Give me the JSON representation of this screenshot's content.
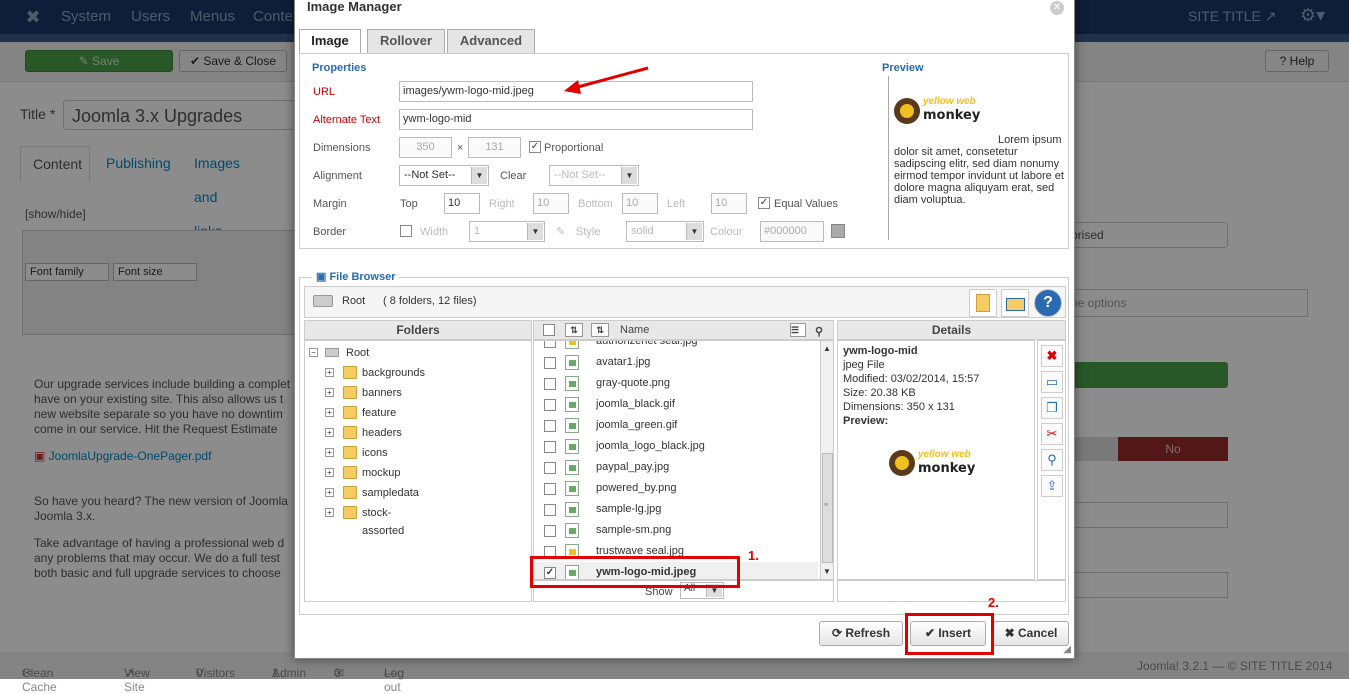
{
  "background": {
    "topbar": {
      "menu": [
        "System",
        "Users",
        "Menus",
        "Conte"
      ],
      "site_title": "SITE TITLE"
    },
    "toolbar": {
      "save": "Save",
      "save_close": "Save & Close",
      "help": "Help"
    },
    "title_label": "Title *",
    "title_value": "Joomla 3.x Upgrades",
    "tabs": [
      "Content",
      "Publishing",
      "Images and links"
    ],
    "show_hide": "[show/hide]",
    "editor_font_family": "Font family",
    "editor_font_size": "Font size",
    "editor_paragraphs": [
      "Our upgrade services include building a complet have on your existing site.  This also allows us t new website separate so you have no downtim come in our service.  Hit the Request Estimate",
      "So have you heard? The new version of Joomla Joomla 3.x.",
      "Take advantage of having a professional web d any problems that may occur. We do a full test both basic and full upgrade services to choose"
    ],
    "pdf_link": "JoomlaUpgrade-OnePager.pdf",
    "right_panel": {
      "select1": "prised",
      "input_placeholder": "ne options",
      "toggle_no": "No"
    },
    "statusbar": {
      "clean_cache": "Clean Cache",
      "view_site": "View Site",
      "visitors_count": "0",
      "visitors": "Visitors",
      "admin_count": "1",
      "admin": "Admin",
      "messages_count": "0",
      "logout": "Log out",
      "footer": "Joomla! 3.2.1 — © SITE TITLE 2014"
    }
  },
  "dialog": {
    "title": "Image Manager",
    "tabs": [
      "Image",
      "Rollover",
      "Advanced"
    ],
    "properties": {
      "section_title": "Properties",
      "url_label": "URL",
      "url_value": "images/ywm-logo-mid.jpeg",
      "alt_label": "Alternate Text",
      "alt_value": "ywm-logo-mid",
      "dimensions_label": "Dimensions",
      "width": "350",
      "height": "131",
      "times": "×",
      "proportional": "Proportional",
      "proportional_checked": true,
      "alignment_label": "Alignment",
      "alignment_value": "--Not Set--",
      "clear_label": "Clear",
      "clear_value": "--Not Set--",
      "margin_label": "Margin",
      "top_label": "Top",
      "top_value": "10",
      "right_label": "Right",
      "right_value": "10",
      "bottom_label": "Bottom",
      "bottom_value": "10",
      "left_label": "Left",
      "left_value": "10",
      "equal_values": "Equal Values",
      "equal_checked": true,
      "border_label": "Border",
      "border_width_label": "Width",
      "border_width_value": "1",
      "border_style_label": "Style",
      "border_style_value": "solid",
      "border_colour_label": "Colour",
      "border_colour_value": "#000000"
    },
    "preview": {
      "title": "Preview",
      "text": "Lorem ipsum dolor sit amet, consetetur sadipscing elitr, sed diam nonumy eirmod tempor invidunt ut labore et dolore magna aliquyam erat, sed diam voluptua."
    },
    "logo": {
      "line1": "yellow web",
      "line2": "monkey"
    },
    "file_browser": {
      "legend": "File Browser",
      "root": "Root",
      "root_info": "( 8 folders, 12 files)",
      "folders_header": "Folders",
      "name_header": "Name",
      "details_header": "Details",
      "folder_root": "Root",
      "folders": [
        "backgrounds",
        "banners",
        "feature",
        "headers",
        "icons",
        "mockup",
        "sampledata",
        "stock-assorted"
      ],
      "files": [
        {
          "name": "authorizenet seal.jpg",
          "checked": false,
          "warn": true
        },
        {
          "name": "avatar1.jpg",
          "checked": false,
          "warn": false
        },
        {
          "name": "gray-quote.png",
          "checked": false,
          "warn": false
        },
        {
          "name": "joomla_black.gif",
          "checked": false,
          "warn": false
        },
        {
          "name": "joomla_green.gif",
          "checked": false,
          "warn": false
        },
        {
          "name": "joomla_logo_black.jpg",
          "checked": false,
          "warn": false
        },
        {
          "name": "paypal_pay.jpg",
          "checked": false,
          "warn": false
        },
        {
          "name": "powered_by.png",
          "checked": false,
          "warn": false
        },
        {
          "name": "sample-lg.jpg",
          "checked": false,
          "warn": false
        },
        {
          "name": "sample-sm.png",
          "checked": false,
          "warn": false
        },
        {
          "name": "trustwave seal.jpg",
          "checked": false,
          "warn": true
        },
        {
          "name": "ywm-logo-mid.jpeg",
          "checked": true,
          "warn": false
        }
      ],
      "show_label": "Show",
      "show_value": "All",
      "details": {
        "name": "ywm-logo-mid",
        "type": "jpeg File",
        "modified": "Modified: 03/02/2014, 15:57",
        "size": "Size: 20.38 KB",
        "dimensions": "Dimensions: 350 x 131",
        "preview_label": "Preview:"
      }
    },
    "buttons": {
      "refresh": "Refresh",
      "insert": "Insert",
      "cancel": "Cancel"
    }
  },
  "annotations": {
    "step1": "1.",
    "step2": "2.",
    "color": "#e00000"
  }
}
